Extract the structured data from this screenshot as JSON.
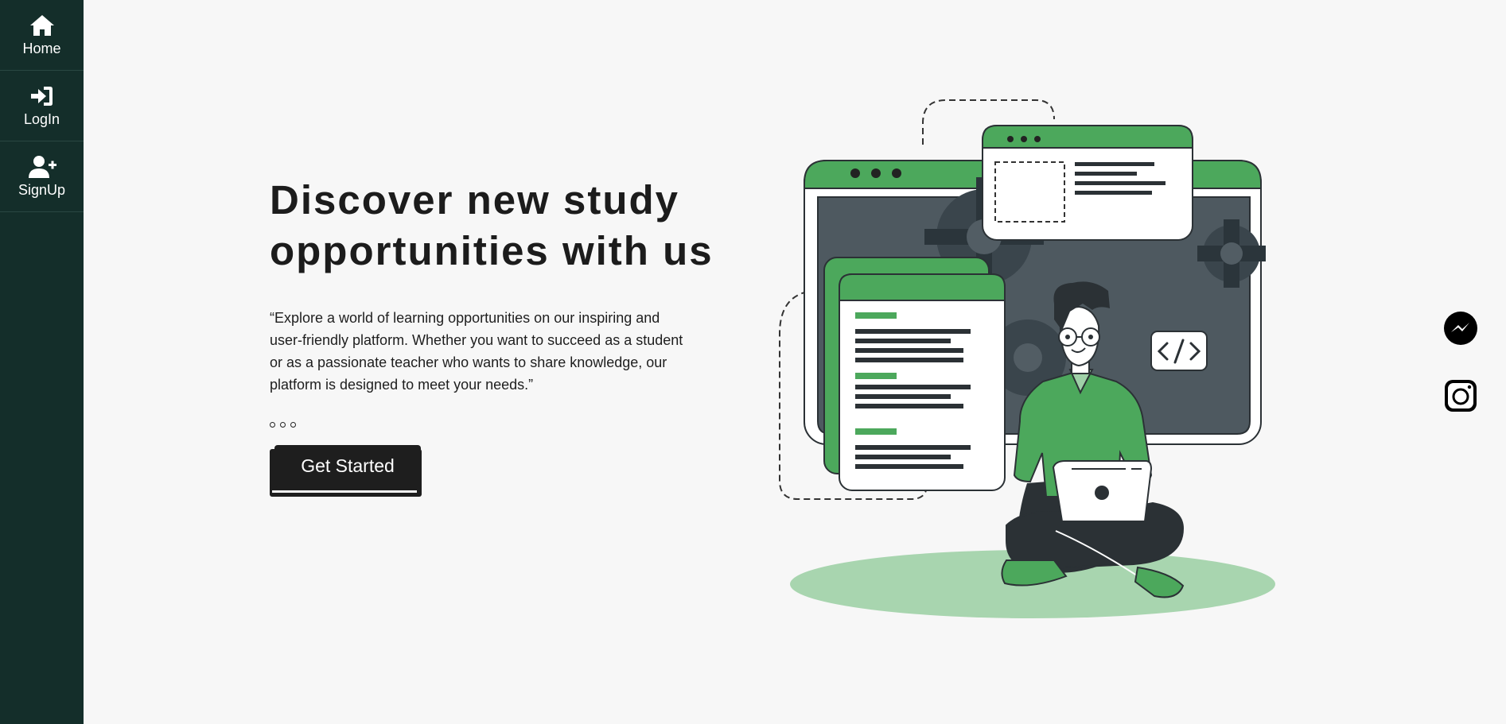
{
  "sidebar": {
    "items": [
      {
        "label": "Home",
        "icon": "home-icon"
      },
      {
        "label": "LogIn",
        "icon": "login-icon"
      },
      {
        "label": "SignUp",
        "icon": "user-plus-icon"
      }
    ]
  },
  "hero": {
    "title": "Discover new study opportunities with us",
    "description": "“Explore a world of learning opportunities on our inspiring and user-friendly platform. Whether you want to succeed as a student or as a passionate teacher who wants to share knowledge, our platform is designed to meet your needs.”",
    "cta_label": "Get Started"
  },
  "social": [
    "messenger-icon",
    "instagram-icon"
  ],
  "colors": {
    "sidebar": "#142e2a",
    "accent_green": "#4ca85c",
    "dark": "#1e1e1e",
    "background": "#f7f7f7"
  }
}
